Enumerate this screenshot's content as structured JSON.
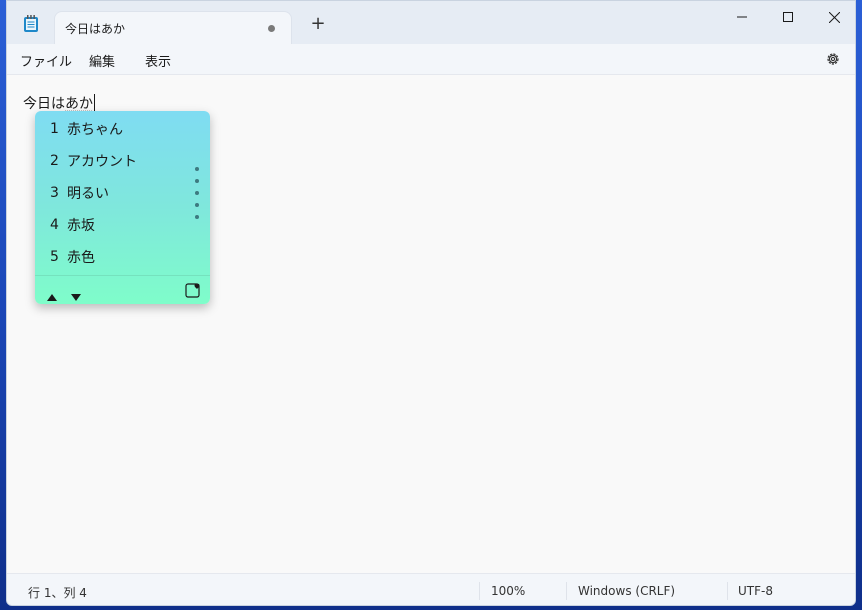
{
  "tab": {
    "title": "今日はあか"
  },
  "menu": {
    "file": "ファイル",
    "edit": "編集",
    "view": "表示"
  },
  "editor": {
    "committed_text": "今日は",
    "composing_text": "あか"
  },
  "ime": {
    "candidates": [
      {
        "num": "1",
        "text": "赤ちゃん"
      },
      {
        "num": "2",
        "text": "アカウント"
      },
      {
        "num": "3",
        "text": "明るい"
      },
      {
        "num": "4",
        "text": "赤坂"
      },
      {
        "num": "5",
        "text": "赤色"
      }
    ]
  },
  "status": {
    "position": "行 1、列 4",
    "zoom": "100%",
    "line_ending": "Windows (CRLF)",
    "encoding": "UTF-8"
  },
  "icons": {
    "app": "notepad-icon",
    "settings": "gear-icon",
    "new_tab": "plus-icon",
    "favorite": "heart-icon"
  },
  "colors": {
    "ime_top": "#7fdcf2",
    "ime_bottom": "#7ffdca"
  }
}
